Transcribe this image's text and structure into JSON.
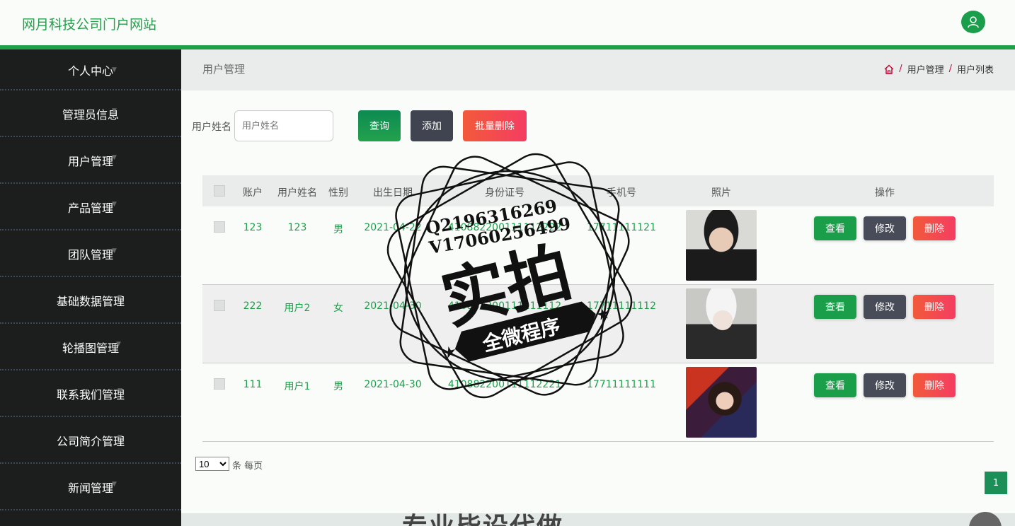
{
  "header": {
    "site_title": "网月科技公司门户网站",
    "avatar_icon": "user-icon"
  },
  "sidebar": {
    "items": [
      {
        "label": "个人中心"
      },
      {
        "label": "管理员信息"
      },
      {
        "label": "用户管理"
      },
      {
        "label": "产品管理"
      },
      {
        "label": "团队管理"
      },
      {
        "label": "基础数据管理"
      },
      {
        "label": "轮播图管理"
      },
      {
        "label": "联系我们管理"
      },
      {
        "label": "公司简介管理"
      },
      {
        "label": "新闻管理"
      }
    ]
  },
  "breadcrumb": {
    "page_title": "用户管理",
    "home_icon": "home-icon",
    "level1": "用户管理",
    "level2": "用户列表"
  },
  "search": {
    "label": "用户姓名",
    "placeholder": "用户姓名",
    "query_label": "查询",
    "add_label": "添加",
    "batch_delete_label": "批量删除"
  },
  "table": {
    "columns": [
      "账户",
      "用户姓名",
      "性别",
      "出生日期",
      "身份证号",
      "手机号",
      "照片",
      "操作"
    ],
    "rows": [
      {
        "account": "123",
        "name": "123",
        "gender": "男",
        "birth": "2021-04-22",
        "id_no": "410882200111112222",
        "phone": "17711111121"
      },
      {
        "account": "222",
        "name": "用户2",
        "gender": "女",
        "birth": "2021-04-30",
        "id_no": "410882200111111112",
        "phone": "17711111112"
      },
      {
        "account": "111",
        "name": "用户1",
        "gender": "男",
        "birth": "2021-04-30",
        "id_no": "410882200111112221",
        "phone": "17711111111"
      }
    ],
    "view_label": "查看",
    "edit_label": "修改",
    "delete_label": "删除"
  },
  "pagination": {
    "page_size": "10",
    "page_size_suffix": "条 每页",
    "current_page": "1"
  },
  "footer": {
    "text": "专业毕设代做"
  },
  "watermark": {
    "line1": "Q2196316269",
    "line2": "V17060256499",
    "main": "实拍",
    "banner": "全微程序"
  }
}
